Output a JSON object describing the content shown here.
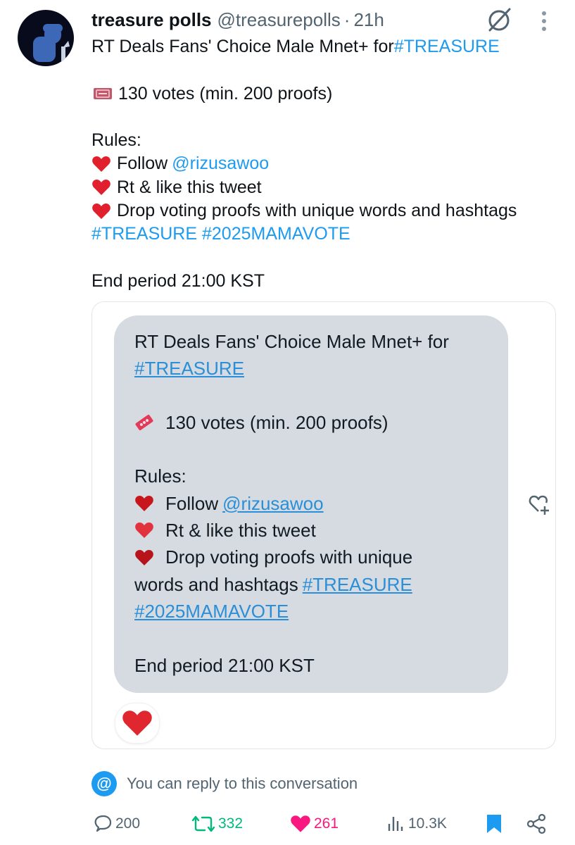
{
  "author": {
    "display_name": "treasure polls",
    "handle": "@treasurepolls",
    "separator": "·",
    "time": "21h"
  },
  "tweet": {
    "title_prefix": "RT Deals Fans' Choice Male Mnet+ for ",
    "title_hashtag": "#TREASURE",
    "votes": "130 votes (min. 200 proofs)",
    "rules_label": "Rules:",
    "rule1_prefix": "Follow ",
    "rule1_mention": "@rizusawoo",
    "rule2": "Rt & like this tweet",
    "rule3": "Drop voting proofs with unique words and hashtags",
    "hashtags": "#TREASURE #2025MAMAVOTE",
    "end_period": "End period 21:00 KST"
  },
  "quoted": {
    "line1": "RT Deals Fans' Choice Male Mnet+ for",
    "line2_hashtag": "#TREASURE",
    "votes": "130 votes (min. 200 proofs)",
    "rules_label": "Rules:",
    "rule1_prefix": "Follow ",
    "rule1_mention": "@rizusawoo",
    "rule2": "Rt & like this tweet",
    "rule3_line1": "Drop voting proofs with unique",
    "rule3_line2_prefix": "words and hashtags ",
    "rule3_line2_hashtag": "#TREASURE",
    "hashtag2": "#2025MAMAVOTE",
    "end_period": "End period 21:00 KST"
  },
  "reply_notice": {
    "at_symbol": "@",
    "text": "You can reply to this conversation"
  },
  "actions": {
    "replies": "200",
    "retweets": "332",
    "likes": "261",
    "views": "10.3K"
  },
  "colors": {
    "link": "#1d9bf0",
    "retweet": "#00ba7c",
    "like": "#f91880",
    "muted": "#536471",
    "bubble": "#d5dbe0"
  },
  "icons": [
    "grok-icon",
    "more-icon",
    "ticket-icon",
    "heart-icon",
    "add-reaction-icon",
    "reply-icon",
    "retweet-icon",
    "like-icon",
    "views-icon",
    "bookmark-icon",
    "share-icon"
  ]
}
